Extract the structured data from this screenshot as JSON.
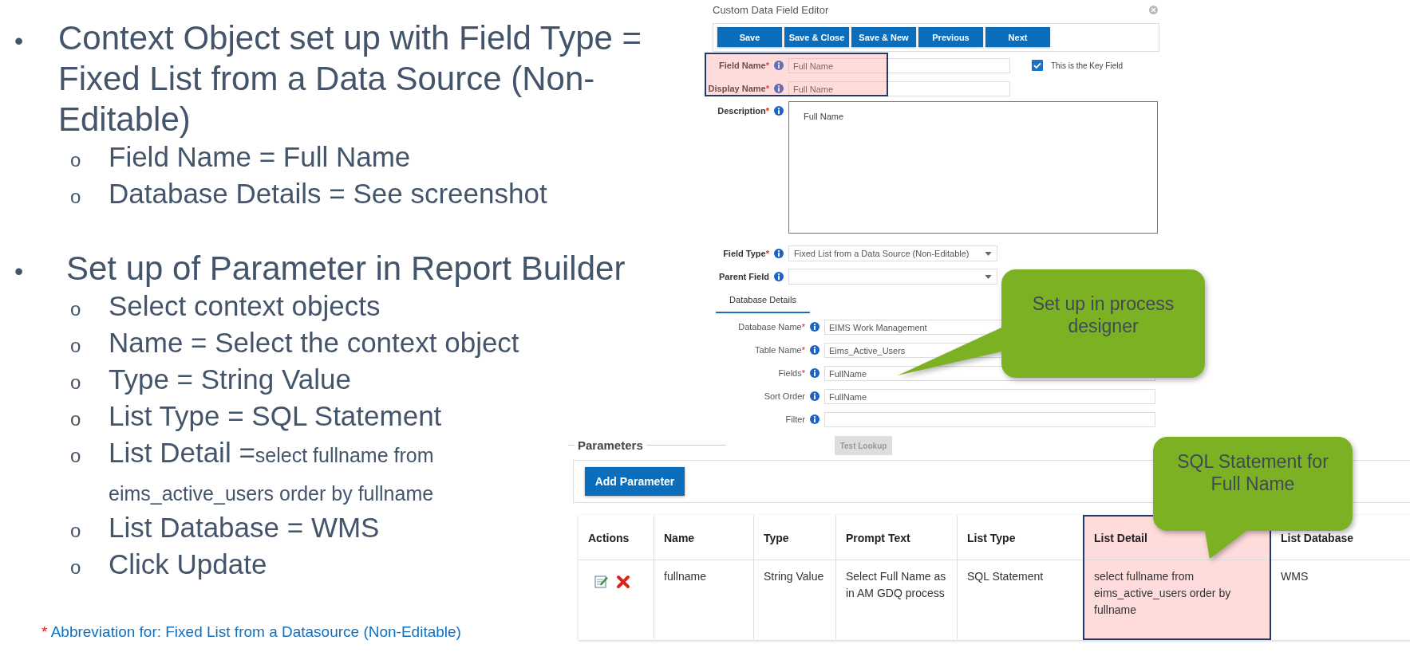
{
  "slide": {
    "bullets": [
      {
        "marker": "•",
        "text": "Context Object set up with Field Type = Fixed List from a Data Source (Non-Editable)",
        "children": [
          {
            "marker": "o",
            "text": "Field Name = Full Name"
          },
          {
            "marker": "o",
            "text": "Database Details = See screenshot"
          }
        ]
      },
      {
        "marker": "•",
        "text": "Set up of Parameter in Report Builder",
        "children": [
          {
            "marker": "o",
            "text": "Select context objects"
          },
          {
            "marker": "o",
            "text": "Name = Select the context object"
          },
          {
            "marker": "o",
            "text": "Type = String Value"
          },
          {
            "marker": "o",
            "text": "List Type = SQL Statement"
          },
          {
            "marker": "o",
            "text": "List Detail =",
            "small_text": "select fullname from eims_active_users order by fullname"
          },
          {
            "marker": "o",
            "text": "List Database = WMS"
          },
          {
            "marker": "o",
            "text": "Click Update"
          }
        ]
      }
    ],
    "footnote": {
      "mark": "*",
      "text": "Abbreviation for: Fixed List from a Datasource (Non-Editable)"
    }
  },
  "dialog": {
    "title": "Custom Data Field Editor",
    "required_mark": "*",
    "highlight_key_rows": true,
    "buttons": [
      "Save",
      "Save & Close",
      "Save & New",
      "Previous",
      "Next"
    ],
    "rows": [
      {
        "kind": "text",
        "label": "Field Name",
        "required": true,
        "value": "Full Name"
      },
      {
        "kind": "text",
        "label": "Display Name",
        "required": true,
        "value": "Full Name"
      },
      {
        "kind": "textarea",
        "label": "Description",
        "required": true,
        "value": "Full Name"
      },
      {
        "kind": "select",
        "label": "Field Type",
        "required": true,
        "value": "Fixed List from a Data Source (Non-Editable)"
      },
      {
        "kind": "select",
        "label": "Parent Field",
        "required": false
      }
    ],
    "key_field": {
      "label": "This is the Key Field",
      "checked": true
    },
    "tab": {
      "label": "Database Details",
      "selected": true
    },
    "db_rows": [
      {
        "label": "Database Name",
        "required": true,
        "value": "EIMS Work Management"
      },
      {
        "label": "Table Name",
        "required": true,
        "value": "Eims_Active_Users"
      },
      {
        "label": "Fields",
        "required": true,
        "value": "FullName"
      },
      {
        "label": "Sort Order",
        "required": false,
        "value": "FullName"
      },
      {
        "label": "Filter",
        "required": false
      }
    ],
    "test_lookup": {
      "label": "Test Lookup",
      "disabled": true
    }
  },
  "parameters": {
    "title": "Parameters",
    "add_button": "Add Parameter",
    "columns": [
      {
        "label": "Actions",
        "highlighted": false
      },
      {
        "label": "Name",
        "highlighted": false
      },
      {
        "label": "Type",
        "highlighted": false
      },
      {
        "label": "Prompt Text",
        "highlighted": false
      },
      {
        "label": "List Type",
        "highlighted": false
      },
      {
        "label": "List Detail",
        "highlighted": true
      },
      {
        "label": "List Database",
        "highlighted": false
      }
    ],
    "rows": [
      {
        "cells": [
          "",
          "fullname",
          "String Value",
          "Select Full Name as in AM GDQ process",
          "SQL Statement",
          "select fullname from eims_active_users order by fullname",
          "WMS"
        ]
      }
    ]
  },
  "callouts": [
    {
      "text": "Set up in process designer"
    },
    {
      "text": "SQL Statement for Full Name"
    }
  ]
}
